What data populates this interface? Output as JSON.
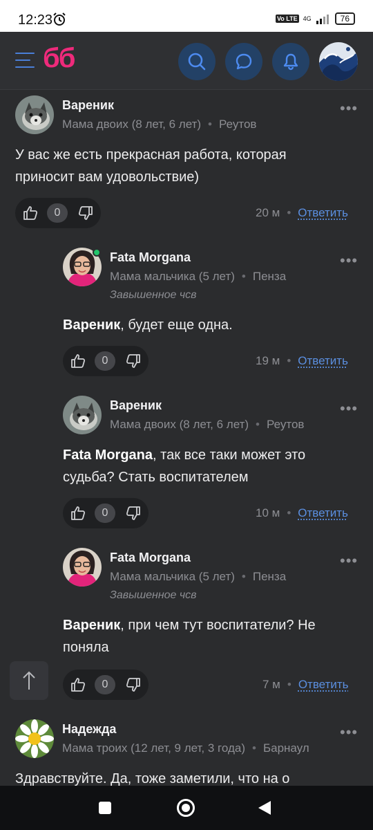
{
  "status_bar": {
    "time": "12:23",
    "network": "4G",
    "volte": "Vo LTE",
    "battery": "76"
  },
  "header": {
    "logo": "бб"
  },
  "comments": [
    {
      "author": "Вареник",
      "meta_family": "Мама двоих (8 лет, 6 лет)",
      "meta_city": "Реутов",
      "text": "У вас же есть прекрасная работа, которая приносит вам удовольствие)",
      "votes": "0",
      "time": "20 м",
      "reply": "Ответить"
    },
    {
      "author": "Fata Morgana",
      "meta_family": "Мама мальчика (5 лет)",
      "meta_city": "Пенза",
      "status": "Завышенное чсв",
      "mention": "Вареник",
      "text": ", будет еще одна.",
      "votes": "0",
      "time": "19 м",
      "reply": "Ответить"
    },
    {
      "author": "Вареник",
      "meta_family": "Мама двоих (8 лет, 6 лет)",
      "meta_city": "Реутов",
      "mention": "Fata Morgana",
      "text": ", так все таки может это судьба? Стать воспитателем",
      "votes": "0",
      "time": "10 м",
      "reply": "Ответить"
    },
    {
      "author": "Fata Morgana",
      "meta_family": "Мама мальчика (5 лет)",
      "meta_city": "Пенза",
      "status": "Завышенное чсв",
      "mention": "Вареник",
      "text": ", при чем тут воспитатели? Не поняла",
      "votes": "0",
      "time": "7 м",
      "reply": "Ответить"
    },
    {
      "author": "Надежда",
      "meta_family": "Мама троих (12 лет, 9 лет, 3 года)",
      "meta_city": "Барнаул",
      "text": "Здравствуйте. Да, тоже заметили, что на о"
    }
  ]
}
